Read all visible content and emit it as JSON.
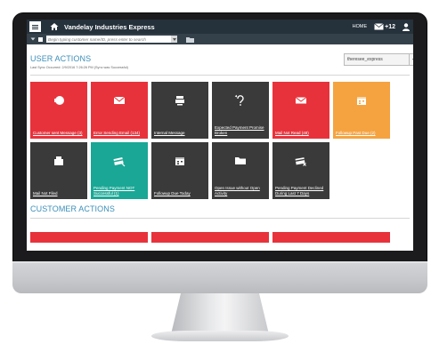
{
  "header": {
    "app_title": "Vandelay Industries Express",
    "home_link": "HOME",
    "mail_count": "+12"
  },
  "search": {
    "placeholder": "Begin typing customer name/ID, press enter to search"
  },
  "user_actions": {
    "title": "USER ACTIONS",
    "last_sync": "Last Sync Occurred: 2/9/2016 7:26:26 PM (Sync was Successful)",
    "selected_user": "theresee_express",
    "tiles": [
      {
        "label": "Customer sent Message (3)",
        "color": "red",
        "icon": "message-icon"
      },
      {
        "label": "Error Sending Email (134)",
        "color": "red",
        "icon": "email-error-icon"
      },
      {
        "label": "Internal Message",
        "color": "dark",
        "icon": "internal-message-icon"
      },
      {
        "label": "Expected Payment Promise Broken",
        "color": "dark",
        "icon": "broken-promise-icon"
      },
      {
        "label": "Mail Not Read (48)",
        "color": "red",
        "icon": "mail-icon"
      },
      {
        "label": "Followup Past Due (2)",
        "color": "orange",
        "icon": "calendar-icon"
      },
      {
        "label": "Mail Not Filed",
        "color": "dark",
        "icon": "file-mail-icon"
      },
      {
        "label": "Pending Payment NOT Successful (1)",
        "color": "teal",
        "icon": "payment-icon"
      },
      {
        "label": "Followup Due Today",
        "color": "dark",
        "icon": "calendar-icon"
      },
      {
        "label": "Open Issue without Open Activity",
        "color": "dark",
        "icon": "folder-icon"
      },
      {
        "label": "Pending Payment Declined During Last 7 Days",
        "color": "dark",
        "icon": "card-declined-icon"
      }
    ]
  },
  "customer_actions": {
    "title": "CUSTOMER ACTIONS"
  },
  "colors": {
    "red": "#e8323b",
    "dark": "#3a3a3a",
    "orange": "#f5a340",
    "teal": "#1aa795",
    "topbar": "#25313b",
    "section_title": "#3c8fb9"
  }
}
